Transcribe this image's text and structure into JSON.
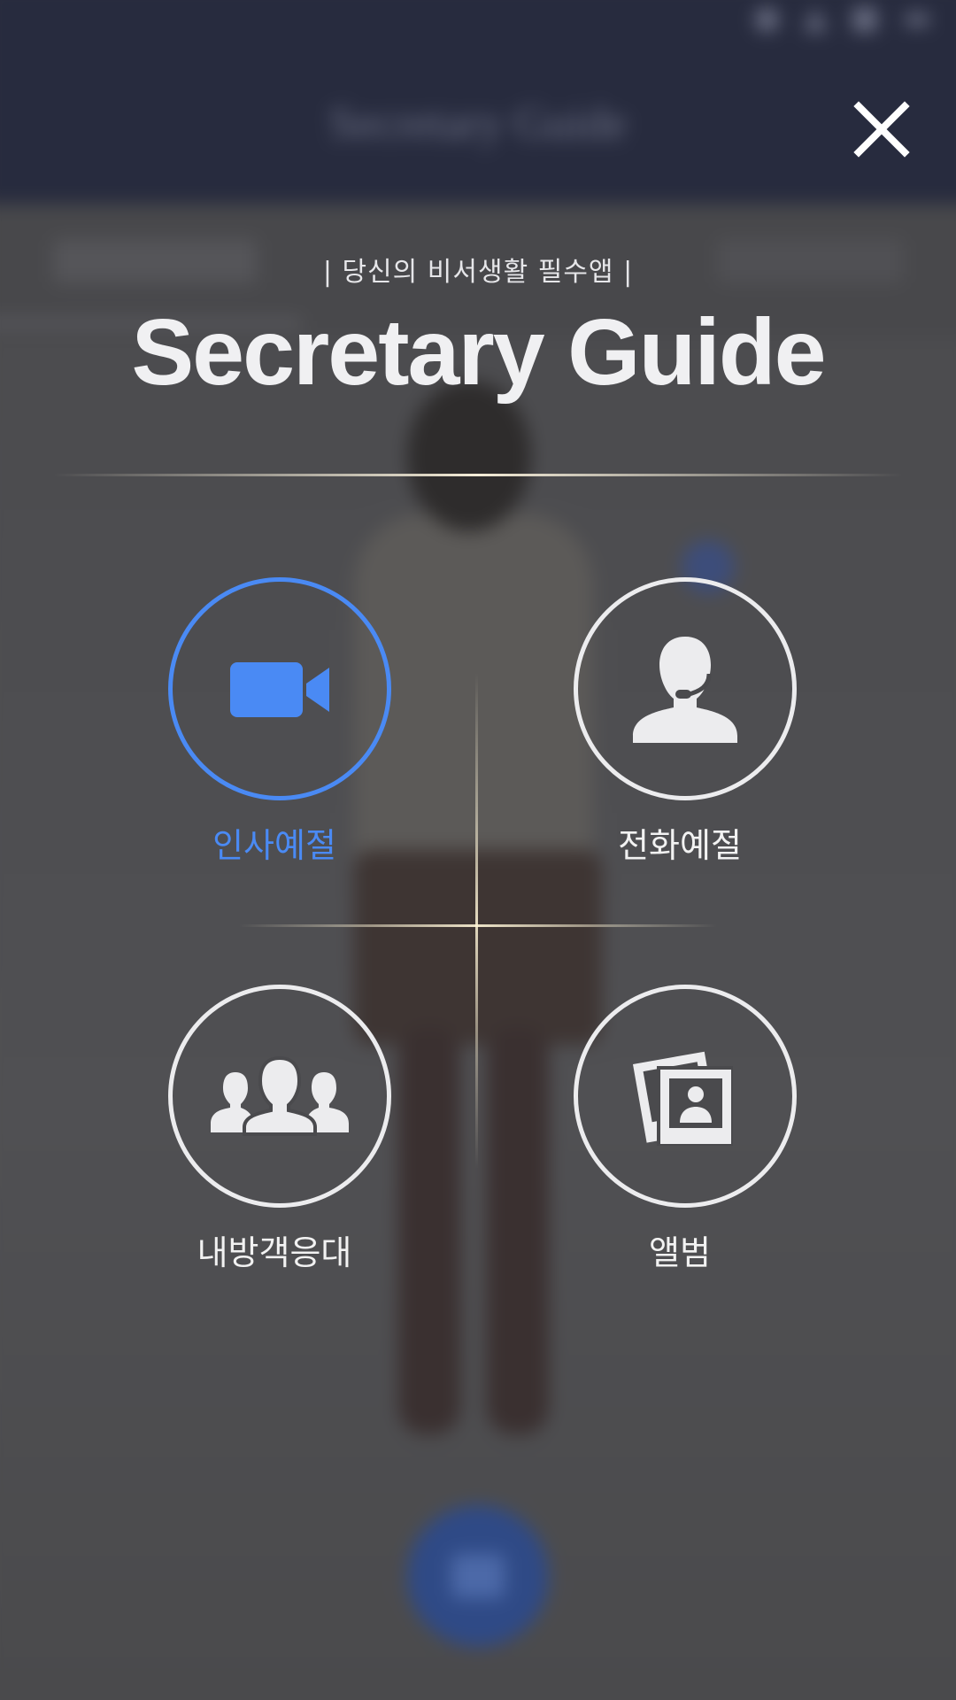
{
  "background": {
    "app_title": "Secretary Guide"
  },
  "overlay": {
    "subtitle": "| 당신의 비서생활 필수앱 |",
    "title": "Secretary Guide",
    "close_icon": "close-icon"
  },
  "menu": {
    "items": [
      {
        "label": "인사예절",
        "icon": "video-camera-icon",
        "active": true
      },
      {
        "label": "전화예절",
        "icon": "headset-person-icon",
        "active": false
      },
      {
        "label": "내방객응대",
        "icon": "group-people-icon",
        "active": false
      },
      {
        "label": "앨범",
        "icon": "photo-album-icon",
        "active": false
      }
    ]
  },
  "colors": {
    "accent": "#4a8af4",
    "icon_default": "#ececee",
    "header_bg": "#272b3e",
    "overlay_bg": "#4a4a4d"
  }
}
